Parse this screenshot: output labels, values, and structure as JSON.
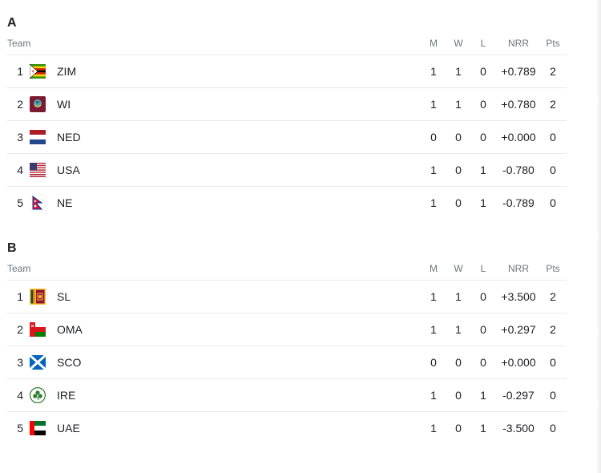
{
  "columns": {
    "team": "Team",
    "m": "M",
    "w": "W",
    "l": "L",
    "nrr": "NRR",
    "pts": "Pts"
  },
  "groups": [
    {
      "title": "A",
      "rows": [
        {
          "rank": "1",
          "team": "ZIM",
          "flag": "zimbabwe-flag-icon",
          "m": "1",
          "w": "1",
          "l": "0",
          "nrr": "+0.789",
          "pts": "2"
        },
        {
          "rank": "2",
          "team": "WI",
          "flag": "west-indies-flag-icon",
          "m": "1",
          "w": "1",
          "l": "0",
          "nrr": "+0.780",
          "pts": "2"
        },
        {
          "rank": "3",
          "team": "NED",
          "flag": "netherlands-flag-icon",
          "m": "0",
          "w": "0",
          "l": "0",
          "nrr": "+0.000",
          "pts": "0"
        },
        {
          "rank": "4",
          "team": "USA",
          "flag": "usa-flag-icon",
          "m": "1",
          "w": "0",
          "l": "1",
          "nrr": "-0.780",
          "pts": "0"
        },
        {
          "rank": "5",
          "team": "NE",
          "flag": "nepal-flag-icon",
          "m": "1",
          "w": "0",
          "l": "1",
          "nrr": "-0.789",
          "pts": "0"
        }
      ]
    },
    {
      "title": "B",
      "rows": [
        {
          "rank": "1",
          "team": "SL",
          "flag": "sri-lanka-flag-icon",
          "m": "1",
          "w": "1",
          "l": "0",
          "nrr": "+3.500",
          "pts": "2"
        },
        {
          "rank": "2",
          "team": "OMA",
          "flag": "oman-flag-icon",
          "m": "1",
          "w": "1",
          "l": "0",
          "nrr": "+0.297",
          "pts": "2"
        },
        {
          "rank": "3",
          "team": "SCO",
          "flag": "scotland-flag-icon",
          "m": "0",
          "w": "0",
          "l": "0",
          "nrr": "+0.000",
          "pts": "0"
        },
        {
          "rank": "4",
          "team": "IRE",
          "flag": "ireland-cricket-logo-icon",
          "m": "1",
          "w": "0",
          "l": "1",
          "nrr": "-0.297",
          "pts": "0"
        },
        {
          "rank": "5",
          "team": "UAE",
          "flag": "uae-flag-icon",
          "m": "1",
          "w": "0",
          "l": "1",
          "nrr": "-3.500",
          "pts": "0"
        }
      ]
    }
  ]
}
